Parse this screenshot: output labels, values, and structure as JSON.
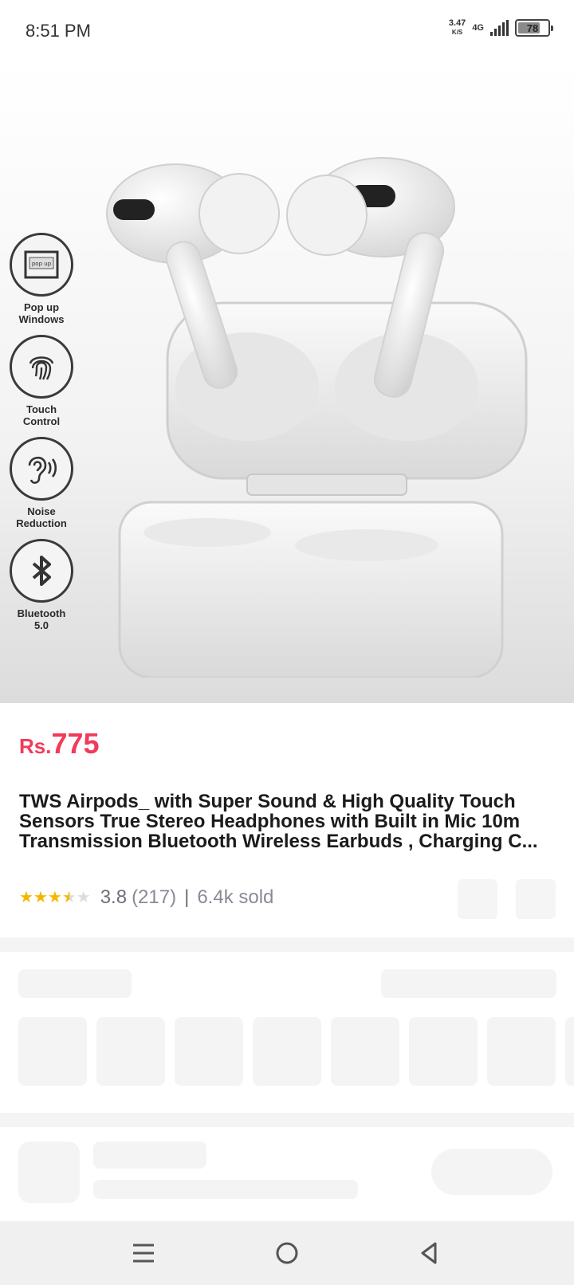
{
  "status_bar": {
    "time": "8:51 PM",
    "net_speed": "3.47",
    "net_speed_unit": "K/S",
    "net_type": "4G",
    "battery": "78",
    "battery_level": 0.78
  },
  "product_image": {
    "features": [
      {
        "label": "Pop up\nWindows",
        "icon": "popup-window-icon",
        "icon_text": "pop up"
      },
      {
        "label": "Touch\nControl",
        "icon": "fingerprint-icon"
      },
      {
        "label": "Noise\nReduction",
        "icon": "ear-icon"
      },
      {
        "label": "Bluetooth\n5.0",
        "icon": "bluetooth-icon"
      }
    ]
  },
  "product": {
    "currency": "Rs.",
    "price": "775",
    "title": "TWS Airpods_ with Super Sound & High Quality Touch Sensors True Stereo Headphones with Built in Mic 10m Transmission Bluetooth Wireless Earbuds , Charging C...",
    "rating_stars": 3.8,
    "rating": "3.8",
    "reviews": "(217)",
    "separator": "|",
    "sold": "6.4k sold"
  },
  "colors": {
    "price": "#f23b5a",
    "star": "#f7b500",
    "skeleton": "#f4f4f4"
  }
}
